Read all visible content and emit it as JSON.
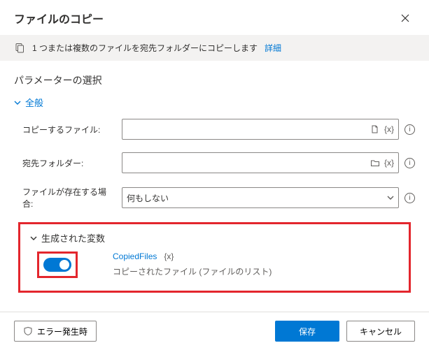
{
  "dialog": {
    "title": "ファイルのコピー",
    "close": "×"
  },
  "banner": {
    "text": "1 つまたは複数のファイルを宛先フォルダーにコピーします",
    "link": "詳細"
  },
  "params": {
    "section_title": "パラメーターの選択",
    "general_label": "全般",
    "fields": {
      "file_to_copy": {
        "label": "コピーするファイル:",
        "value": ""
      },
      "destination": {
        "label": "宛先フォルダー:",
        "value": ""
      },
      "if_exists": {
        "label": "ファイルが存在する場合:",
        "value": "何もしない"
      }
    },
    "var_token": "{x}"
  },
  "generated": {
    "header": "生成された変数",
    "toggle_on": true,
    "variable": {
      "name": "CopiedFiles",
      "token": "{x}",
      "description": "コピーされたファイル (ファイルのリスト)"
    }
  },
  "footer": {
    "on_error": "エラー発生時",
    "save": "保存",
    "cancel": "キャンセル"
  }
}
